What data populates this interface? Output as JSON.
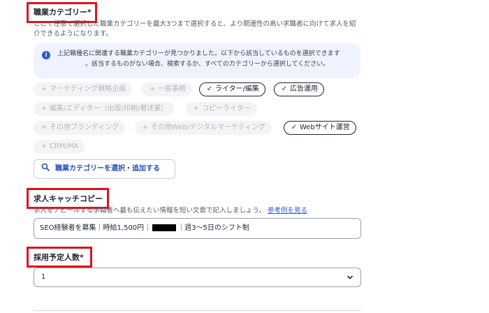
{
  "category_section": {
    "label": "職業カテゴリー*",
    "desc_line1": "ここで任意で選択した職業カテゴリーを最大3つまで選択すると、より関連性の高い求職者に向けて求人を紹",
    "desc_line2": "介できるようになります。",
    "info_line1": "上記職種名に関連する職業カテゴリーが見つかりました。以下から該当しているものを選択できます",
    "info_line2": "。該当するものがない場合、検索するか、すべてのカテゴリーから選択してください。",
    "chips": [
      {
        "label": "マーケティング戦略企画",
        "selected": false
      },
      {
        "label": "一般事務",
        "selected": false
      },
      {
        "label": "ライター/編集",
        "selected": true
      },
      {
        "label": "広告運用",
        "selected": true
      },
      {
        "label": "編集/エディター（出版/印刷/著述業）",
        "selected": false
      },
      {
        "label": "コピーライター",
        "selected": false
      },
      {
        "label": "その他ブランディング",
        "selected": false
      },
      {
        "label": "その他Web/デジタルマーケティング",
        "selected": false
      },
      {
        "label": "Webサイト運営",
        "selected": true
      },
      {
        "label": "CRM/MA",
        "selected": false
      }
    ],
    "select_button_label": "職業カテゴリーを選択・追加する"
  },
  "catchcopy_section": {
    "label": "求人キャッチコピー",
    "desc": "求人をアピールする求職者へ最も伝えたい情報を短い文章で記入しましょう。",
    "example_link": "参考例を見る",
    "value_before": "SEO経験者を募集｜時給1,500円｜",
    "value_after": "｜週3〜5日のシフト制"
  },
  "headcount_section": {
    "label": "採用予定人数*",
    "value": "1"
  },
  "colors": {
    "accent": "#2a4fb8",
    "highlight_border": "#e0121b",
    "info_bg": "#eef3ff"
  }
}
